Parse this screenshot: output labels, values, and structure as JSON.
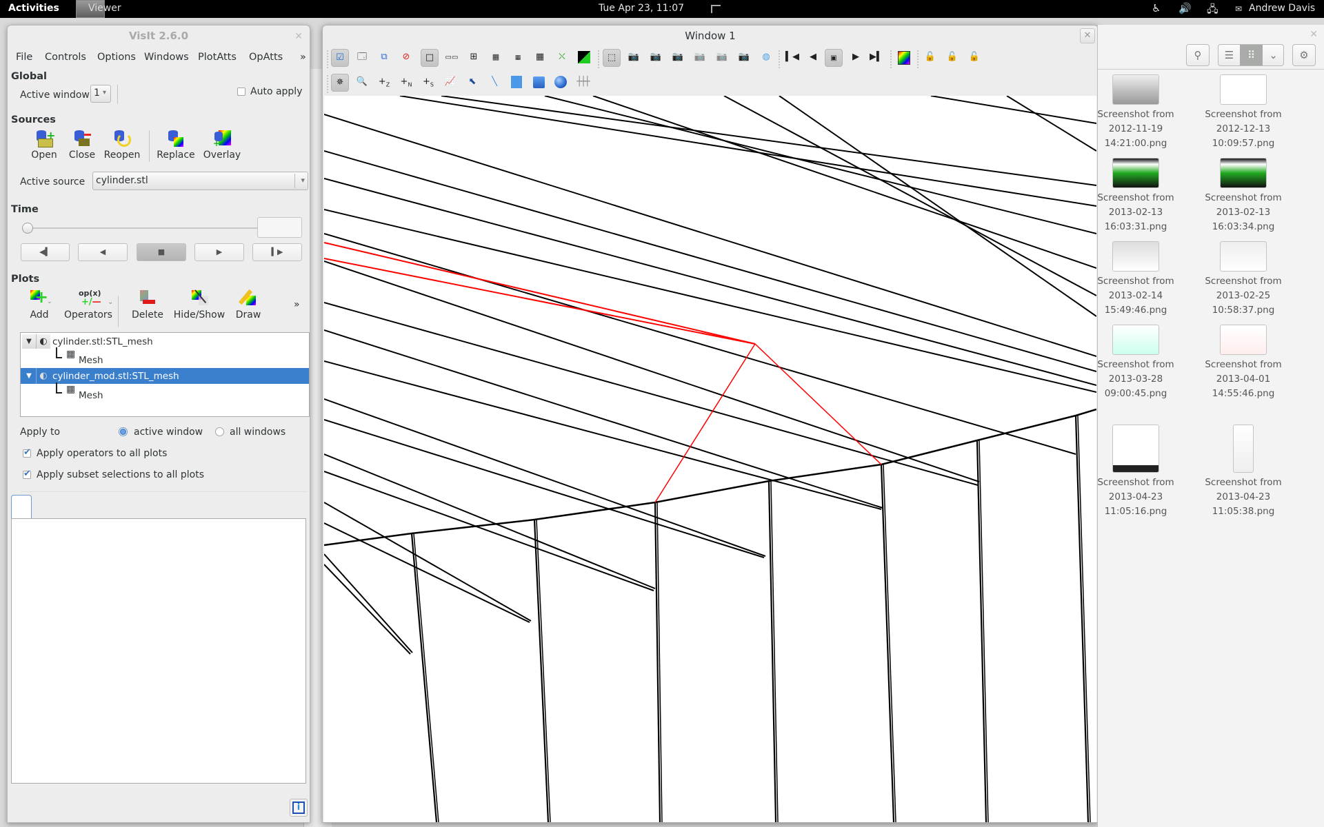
{
  "topbar": {
    "activities": "Activities",
    "app_name": "Viewer",
    "clock": "Tue Apr 23, 11:07",
    "user": "Andrew Davis",
    "icons": [
      "accessibility-icon",
      "volume-icon",
      "network-icon",
      "chat-icon"
    ]
  },
  "visit": {
    "title": "VisIt 2.6.0",
    "menu": [
      "File",
      "Controls",
      "Options",
      "Windows",
      "PlotAtts",
      "OpAtts"
    ],
    "menu_more": "»",
    "global": {
      "heading": "Global",
      "active_window_label": "Active window",
      "active_window_value": "1",
      "auto_apply_label": "Auto apply",
      "auto_apply_checked": false
    },
    "sources": {
      "heading": "Sources",
      "buttons": [
        "Open",
        "Close",
        "Reopen",
        "Replace",
        "Overlay"
      ],
      "active_source_label": "Active source",
      "active_source_value": "cylinder.stl"
    },
    "time": {
      "heading": "Time",
      "slider_position": 0,
      "state_value": "",
      "controls": [
        "step-back",
        "play-reverse",
        "stop",
        "play",
        "step-forward"
      ]
    },
    "plots": {
      "heading": "Plots",
      "buttons": [
        "Add",
        "Operators",
        "Delete",
        "Hide/Show",
        "Draw"
      ],
      "more": "»",
      "operators_icon_text": "op(x)",
      "list": [
        {
          "name": "cylinder.stl:STL_mesh",
          "child": "Mesh",
          "selected": false
        },
        {
          "name": "cylinder_mod.stl:STL_mesh",
          "child": "Mesh",
          "selected": true
        }
      ],
      "apply_to_label": "Apply to",
      "apply_to_options": [
        "active window",
        "all windows"
      ],
      "apply_to_selected": "active window",
      "apply_operators_label": "Apply operators to all plots",
      "apply_operators_checked": true,
      "apply_subset_label": "Apply subset selections to all plots",
      "apply_subset_checked": true
    },
    "output_icon": "info-icon"
  },
  "viewer": {
    "title": "Window 1",
    "toolbar_row1": [
      "active-window",
      "add-window",
      "clone-window",
      "delete-window",
      "layout-1x1",
      "layout-1x2",
      "layout-2x2",
      "layout-2x3",
      "layout-2x4",
      "layout-3x3",
      "clear-plots",
      "invert-background",
      "perspective",
      "reset-view",
      "recenter-view",
      "undo-view",
      "save-view",
      "choose-center",
      "save-image",
      "lock-view",
      "first-frame",
      "prev-frame",
      "stop",
      "next-frame",
      "last-frame",
      "color-table",
      "lock-view-lock",
      "lock-time-lock",
      "lock-tools-lock"
    ],
    "toolbar_row2": [
      "navigate",
      "zoom",
      "zone-pick",
      "node-pick",
      "spreadsheet-pick",
      "lineout",
      "point-tool",
      "line-tool",
      "plane-tool",
      "box-tool",
      "sphere-tool",
      "axis-restriction-tool"
    ],
    "toolbar_row2_labels": {
      "zone_pick": "Z",
      "node_pick": "N",
      "spreadsheet_pick": "S"
    }
  },
  "files": {
    "items": [
      {
        "line1": "Screenshot from",
        "line2": "2012-11-19",
        "line3": "14:21:00.png"
      },
      {
        "line1": "Screenshot from",
        "line2": "2012-12-13",
        "line3": "10:09:57.png"
      },
      {
        "line1": "Screenshot from",
        "line2": "2013-02-13",
        "line3": "16:03:31.png"
      },
      {
        "line1": "Screenshot from",
        "line2": "2013-02-13",
        "line3": "16:03:34.png"
      },
      {
        "line1": "Screenshot from",
        "line2": "2013-02-14",
        "line3": "15:49:46.png"
      },
      {
        "line1": "Screenshot from",
        "line2": "2013-02-25",
        "line3": "10:58:37.png"
      },
      {
        "line1": "Screenshot from",
        "line2": "2013-03-28",
        "line3": "09:00:45.png"
      },
      {
        "line1": "Screenshot from",
        "line2": "2013-04-01",
        "line3": "14:55:46.png"
      },
      {
        "line1": "Screenshot from",
        "line2": "2013-04-23",
        "line3": "11:05:16.png"
      },
      {
        "line1": "Screenshot from",
        "line2": "2013-04-23",
        "line3": "11:05:38.png"
      }
    ],
    "view_mode": "grid"
  },
  "colors": {
    "selection": "#3a7fcb",
    "mesh_black": "#000000",
    "mesh_red": "#ff0000"
  }
}
